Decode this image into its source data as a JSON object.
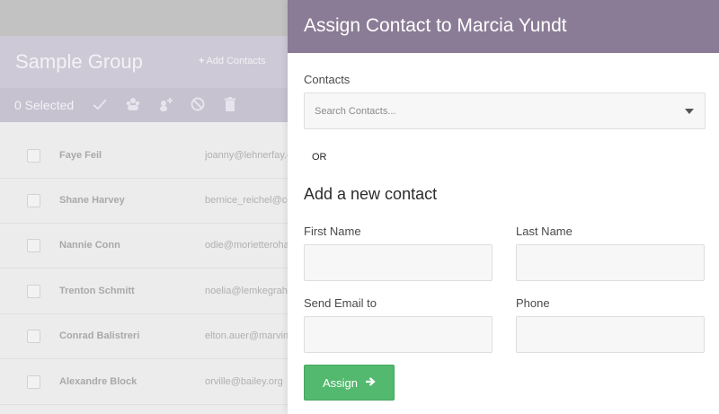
{
  "group": {
    "title": "Sample Group",
    "add_contacts_label": "Add Contacts",
    "selected_label": "0 Selected"
  },
  "toolbar_icons": [
    "check-icon",
    "group-icon",
    "add-user-icon",
    "block-icon",
    "trash-icon"
  ],
  "contacts": [
    {
      "name": "Faye Feil",
      "email": "joanny@lehnerfay.c"
    },
    {
      "name": "Shane Harvey",
      "email": "bernice_reichel@co"
    },
    {
      "name": "Nannie Conn",
      "email": "odie@morietteroha"
    },
    {
      "name": "Trenton Schmitt",
      "email": "noelia@lemkegraha"
    },
    {
      "name": "Conrad Balistreri",
      "email": "elton.auer@marvin."
    },
    {
      "name": "Alexandre Block",
      "email": "orville@bailey.org"
    }
  ],
  "modal": {
    "title": "Assign Contact to Marcia Yundt",
    "contacts_label": "Contacts",
    "search_placeholder": "Search Contacts...",
    "or_label": "OR",
    "section_title": "Add a new contact",
    "first_name_label": "First Name",
    "first_name_value": "",
    "last_name_label": "Last Name",
    "last_name_value": "",
    "email_label": "Send Email to",
    "email_value": "",
    "phone_label": "Phone",
    "phone_value": "",
    "assign_label": "Assign"
  },
  "colors": {
    "header_purple": "#8a7c96",
    "assign_green": "#52b96e"
  }
}
